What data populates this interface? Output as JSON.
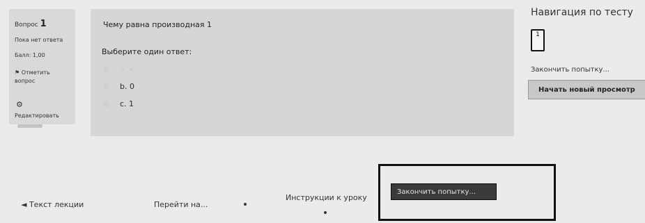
{
  "question_info": {
    "label": "Вопрос",
    "number": "1",
    "status": "Пока нет ответа",
    "grade": "Балл: 1,00",
    "flag_label": "Отметить вопрос",
    "edit_label": "Редактировать"
  },
  "question": {
    "text": "Чему равна производная 1",
    "prompt": "Выберите один ответ:",
    "options": [
      {
        "label": "a. x"
      },
      {
        "label": "b. 0"
      },
      {
        "label": "c. 1"
      }
    ]
  },
  "navigation": {
    "title": "Навигация по тесту",
    "question_number": "1",
    "finish_link": "Закончить попытку...",
    "new_preview_button": "Начать новый просмотр"
  },
  "footer": {
    "prev_lesson": "◄ Текст лекции",
    "goto": "Перейти на...",
    "instructions": "Инструкции к уроку",
    "finish_button": "Закончить попытку..."
  }
}
